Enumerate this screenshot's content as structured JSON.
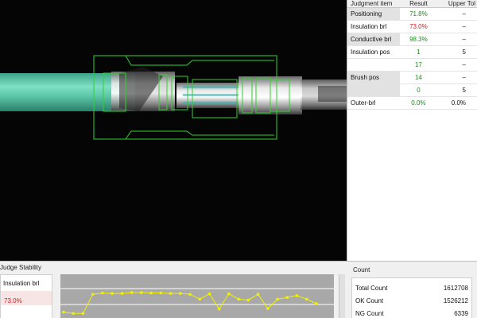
{
  "judgment_table": {
    "headers": [
      "Judgment item",
      "Result",
      "Upper Tol"
    ],
    "rows": [
      {
        "item": "Positioning",
        "result": "71.8%",
        "upper": "–",
        "result_color": "green",
        "shaded": true
      },
      {
        "item": "Insulation brl",
        "result": "73.0%",
        "upper": "–",
        "result_color": "red",
        "shaded": false
      },
      {
        "item": "Conductive brl",
        "result": "98.3%",
        "upper": "–",
        "result_color": "green",
        "shaded": true
      },
      {
        "item": "Insulation pos",
        "result": "1",
        "upper": "5",
        "result_color": "green",
        "shaded": false
      },
      {
        "item": "",
        "result": "17",
        "upper": "–",
        "result_color": "green",
        "shaded": false
      },
      {
        "item": "Brush pos",
        "result": "14",
        "upper": "–",
        "result_color": "green",
        "shaded": true
      },
      {
        "item": "",
        "result": "0",
        "upper": "5",
        "result_color": "green",
        "shaded": true
      },
      {
        "item": "Outer-brl",
        "result": "0.0%",
        "upper": "0.0%",
        "result_color": "green",
        "shaded": false
      }
    ]
  },
  "stability": {
    "title": "Judge Stability",
    "item_label": "Insulation brl",
    "item_value": "73.0%",
    "trend_points": [
      0.15,
      0.12,
      0.12,
      0.55,
      0.58,
      0.57,
      0.57,
      0.59,
      0.59,
      0.58,
      0.58,
      0.57,
      0.57,
      0.55,
      0.44,
      0.56,
      0.22,
      0.56,
      0.44,
      0.42,
      0.55,
      0.23,
      0.44,
      0.48,
      0.52,
      0.44,
      0.34
    ]
  },
  "count": {
    "title": "Count",
    "rows": [
      {
        "label": "Total Count",
        "value": "1612708"
      },
      {
        "label": "OK Count",
        "value": "1526212"
      },
      {
        "label": "NG Count",
        "value": "6339"
      }
    ]
  },
  "colors": {
    "overlay_green": "#2fd22f",
    "ok_green": "#1c8a1c",
    "ng_red": "#d21c1c",
    "trend_yellow": "#f2f200"
  }
}
